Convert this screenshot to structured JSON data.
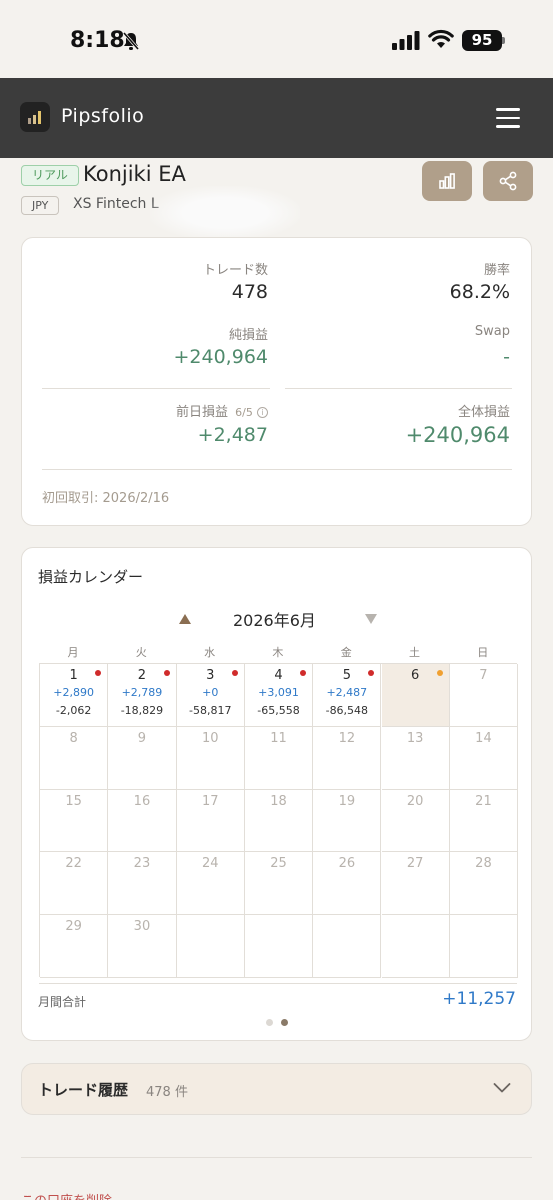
{
  "status_bar": {
    "time": "8:18",
    "battery": "95"
  },
  "app": {
    "brand": "Pipsfolio"
  },
  "account": {
    "type_badge": "リアル",
    "name": "Konjiki EA",
    "currency_badge": "JPY",
    "broker": "XS Fintech L"
  },
  "stats": {
    "trades_label": "トレード数",
    "trades_value": "478",
    "winrate_label": "勝率",
    "winrate_value": "68.2%",
    "net_label": "純損益",
    "net_value": "+240,964",
    "swap_label": "Swap",
    "swap_value": "-",
    "prev_label": "前日損益",
    "prev_date": "6/5",
    "prev_value": "+2,487",
    "total_label": "全体損益",
    "total_value": "+240,964",
    "first_trade": "初回取引: 2026/2/16"
  },
  "calendar": {
    "title": "損益カレンダー",
    "month": "2026年6月",
    "weekdays": [
      "月",
      "火",
      "水",
      "木",
      "金",
      "土",
      "日"
    ],
    "days": [
      {
        "d": "1",
        "pl": "+2,890",
        "sub": "-2,062",
        "dot": "#d02b2b"
      },
      {
        "d": "2",
        "pl": "+2,789",
        "sub": "-18,829",
        "dot": "#d02b2b"
      },
      {
        "d": "3",
        "pl": "+0",
        "sub": "-58,817",
        "dot": "#d02b2b"
      },
      {
        "d": "4",
        "pl": "+3,091",
        "sub": "-65,558",
        "dot": "#d02b2b"
      },
      {
        "d": "5",
        "pl": "+2,487",
        "sub": "-86,548",
        "dot": "#d02b2b"
      },
      {
        "d": "6",
        "today": true,
        "dot": "#f0a030"
      },
      {
        "d": "7",
        "dim": true
      },
      {
        "d": "8",
        "dim": true
      },
      {
        "d": "9",
        "dim": true
      },
      {
        "d": "10",
        "dim": true
      },
      {
        "d": "11",
        "dim": true
      },
      {
        "d": "12",
        "dim": true
      },
      {
        "d": "13",
        "dim": true
      },
      {
        "d": "14",
        "dim": true
      },
      {
        "d": "15",
        "dim": true
      },
      {
        "d": "16",
        "dim": true
      },
      {
        "d": "17",
        "dim": true
      },
      {
        "d": "18",
        "dim": true
      },
      {
        "d": "19",
        "dim": true
      },
      {
        "d": "20",
        "dim": true
      },
      {
        "d": "21",
        "dim": true
      },
      {
        "d": "22",
        "dim": true
      },
      {
        "d": "23",
        "dim": true
      },
      {
        "d": "24",
        "dim": true
      },
      {
        "d": "25",
        "dim": true
      },
      {
        "d": "26",
        "dim": true
      },
      {
        "d": "27",
        "dim": true
      },
      {
        "d": "28",
        "dim": true
      },
      {
        "d": "29",
        "dim": true
      },
      {
        "d": "30",
        "dim": true
      },
      {
        "d": ""
      },
      {
        "d": ""
      },
      {
        "d": ""
      },
      {
        "d": ""
      },
      {
        "d": ""
      }
    ],
    "total_label": "月間合計",
    "total_value": "+11,257"
  },
  "history": {
    "title": "トレード履歴",
    "count": "478 件"
  },
  "footer": {
    "delete_link": "この口座を削除"
  },
  "colors": {
    "accent": "#b09f8a",
    "profit": "#4f8a6c",
    "calendar_positive": "#2f79c8",
    "loss_dot": "#d02b2b",
    "today_dot": "#f0a030"
  }
}
